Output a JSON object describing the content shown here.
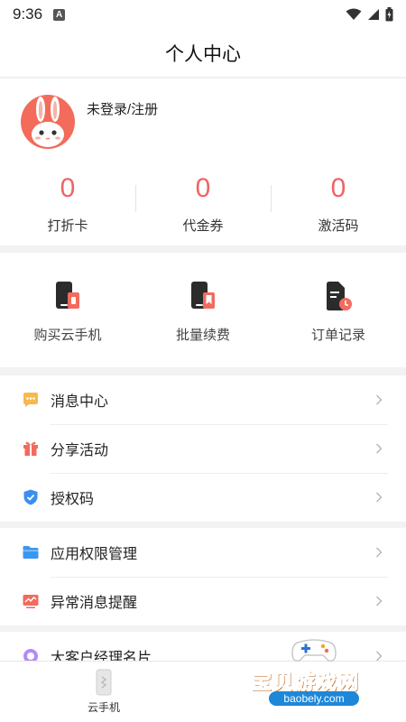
{
  "status_bar": {
    "time": "9:36",
    "notification_badge": "A"
  },
  "header": {
    "title": "个人中心"
  },
  "profile": {
    "login_text": "未登录/注册"
  },
  "stats": [
    {
      "value": "0",
      "label": "打折卡"
    },
    {
      "value": "0",
      "label": "代金券"
    },
    {
      "value": "0",
      "label": "激活码"
    }
  ],
  "shortcuts": [
    {
      "label": "购买云手机",
      "icon": "phone-buy-icon"
    },
    {
      "label": "批量续费",
      "icon": "batch-renew-icon"
    },
    {
      "label": "订单记录",
      "icon": "order-record-icon"
    }
  ],
  "menu_group_1": [
    {
      "label": "消息中心",
      "icon": "message-icon"
    },
    {
      "label": "分享活动",
      "icon": "gift-icon"
    },
    {
      "label": "授权码",
      "icon": "shield-icon"
    }
  ],
  "menu_group_2": [
    {
      "label": "应用权限管理",
      "icon": "folder-icon"
    },
    {
      "label": "异常消息提醒",
      "icon": "alert-chart-icon"
    }
  ],
  "menu_group_3": [
    {
      "label": "大客户经理名片",
      "icon": "manager-card-icon"
    }
  ],
  "tabbar": {
    "items": [
      {
        "label": "云手机",
        "icon": "cloud-phone-icon"
      }
    ]
  },
  "watermark": {
    "text": "宝贝游戏网",
    "url": "baobely.com"
  },
  "colors": {
    "accent": "#ef6464",
    "background": "#f2f2f2",
    "watermark": "#f0a61c"
  }
}
